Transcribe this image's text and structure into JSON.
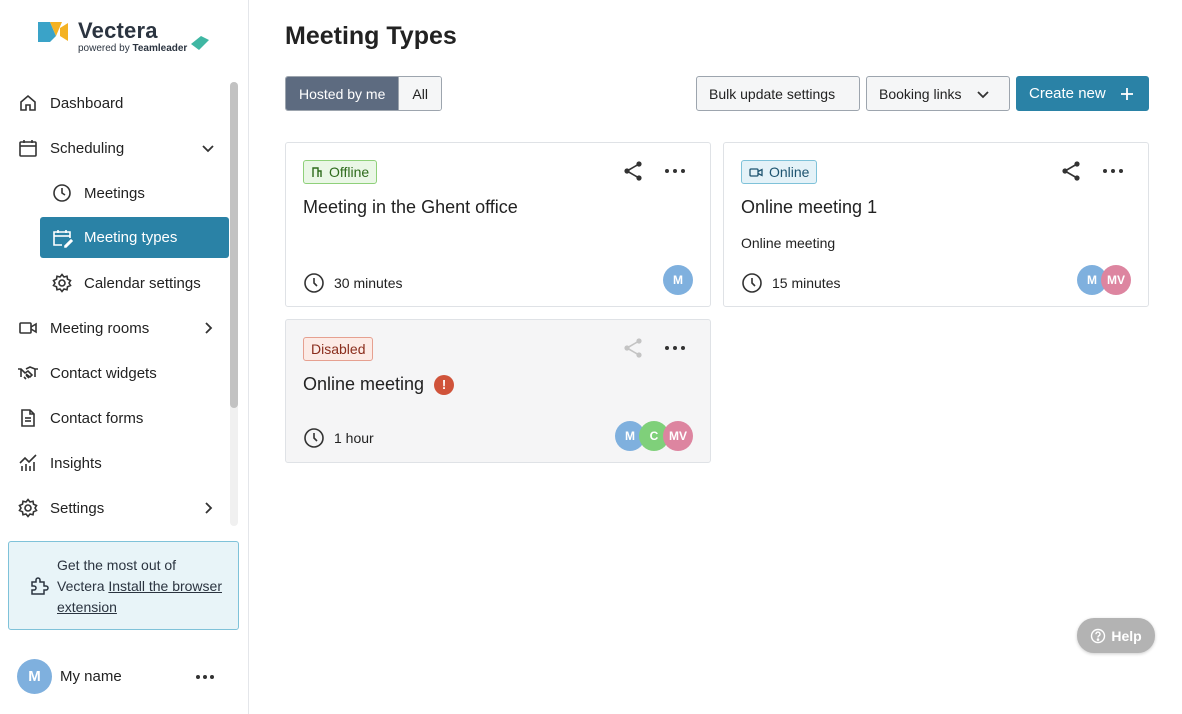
{
  "brand": {
    "name": "Vectera",
    "sub_prefix": "powered by",
    "sub_brand": "Teamleader"
  },
  "sidebar": {
    "items": [
      {
        "label": "Dashboard",
        "icon": "home-icon"
      },
      {
        "label": "Scheduling",
        "icon": "calendar-icon",
        "expanded": true
      },
      {
        "label": "Meetings",
        "icon": "clock-icon"
      },
      {
        "label": "Meeting types",
        "icon": "calendar-edit-icon",
        "active": true
      },
      {
        "label": "Calendar settings",
        "icon": "gear-icon"
      },
      {
        "label": "Meeting rooms",
        "icon": "video-icon"
      },
      {
        "label": "Contact widgets",
        "icon": "handshake-icon"
      },
      {
        "label": "Contact forms",
        "icon": "document-icon"
      },
      {
        "label": "Insights",
        "icon": "chart-icon"
      },
      {
        "label": "Settings",
        "icon": "gear-icon"
      }
    ],
    "promo": {
      "text": "Get the most out of Vectera",
      "link": "Install the browser extension"
    },
    "user": {
      "initial": "M",
      "name": "My name"
    }
  },
  "main": {
    "title": "Meeting Types",
    "filters": [
      "Hosted by me",
      "All"
    ],
    "actions": {
      "bulk": "Bulk update settings",
      "booking": "Booking links",
      "create": "Create new"
    },
    "cards": [
      {
        "status": "Offline",
        "title": "Meeting in the Ghent office",
        "description": "",
        "duration": "30 minutes",
        "hosts": [
          "M"
        ]
      },
      {
        "status": "Online",
        "title": "Online meeting 1",
        "description": "Online meeting",
        "duration": "15 minutes",
        "hosts": [
          "M",
          "MV"
        ]
      },
      {
        "status": "Disabled",
        "title": "Online meeting",
        "warning": "!",
        "description": "",
        "duration": "1 hour",
        "hosts": [
          "M",
          "C",
          "MV"
        ]
      }
    ],
    "help": "Help"
  },
  "colors": {
    "accent": "#2a82a6",
    "segment_active": "#5d6b80",
    "avatar_m": "#7fb0de",
    "avatar_c": "#7fd07a",
    "avatar_mv": "#dd85a0",
    "warning": "#d0533a"
  }
}
